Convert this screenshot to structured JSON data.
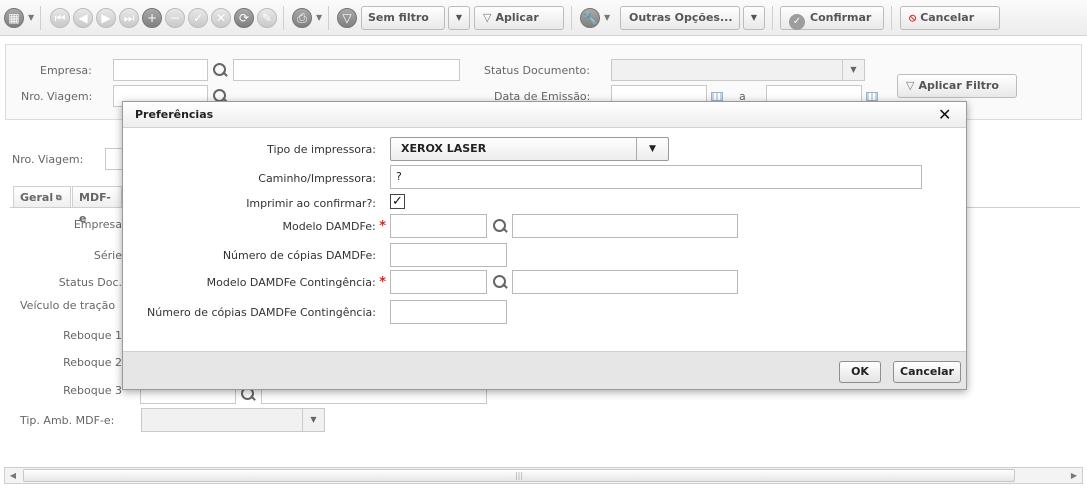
{
  "toolbar": {
    "filter_select_value": "Sem filtro",
    "apply_label": "Aplicar",
    "more_options_label": "Outras Opções...",
    "confirm_label": "Confirmar",
    "cancel_label": "Cancelar"
  },
  "filter": {
    "empresa_label": "Empresa:",
    "viagem_label": "Nro. Viagem:",
    "status_label": "Status Documento:",
    "emissao_label": "Data de Emissão:",
    "date_sep": "a",
    "apply_filter_label": "Aplicar Filtro"
  },
  "form": {
    "viagem_label": "Nro. Viagem:",
    "tabs": [
      {
        "label": "Geral"
      },
      {
        "label": "MDF-e"
      }
    ],
    "fields": {
      "empresa": "Empresa",
      "serie": "Série",
      "status": "Status Doc.",
      "veiculo": "Veículo de tração",
      "reboque1": "Reboque 1",
      "reboque2": "Reboque 2",
      "reboque3": "Reboque 3",
      "tip_amb": "Tip. Amb. MDF-e:"
    }
  },
  "dialog": {
    "title": "Preferências",
    "close_glyph": "✕",
    "printer_type_label": "Tipo de impressora:",
    "printer_type_value": "XEROX LASER",
    "printer_path_label": "Caminho/Impressora:",
    "printer_path_value": "?",
    "print_on_confirm_label": "Imprimir ao confirmar?:",
    "print_on_confirm_checked": true,
    "damdfe_model_label": "Modelo DAMDFe:",
    "damdfe_copies_label": "Número de cópias DAMDFe:",
    "damdfe_cont_model_label": "Modelo DAMDFe Contingência:",
    "damdfe_cont_copies_label": "Número de cópias DAMDFe Contingência:",
    "required_mark": "*",
    "ok_label": "OK",
    "cancel_label": "Cancelar"
  }
}
